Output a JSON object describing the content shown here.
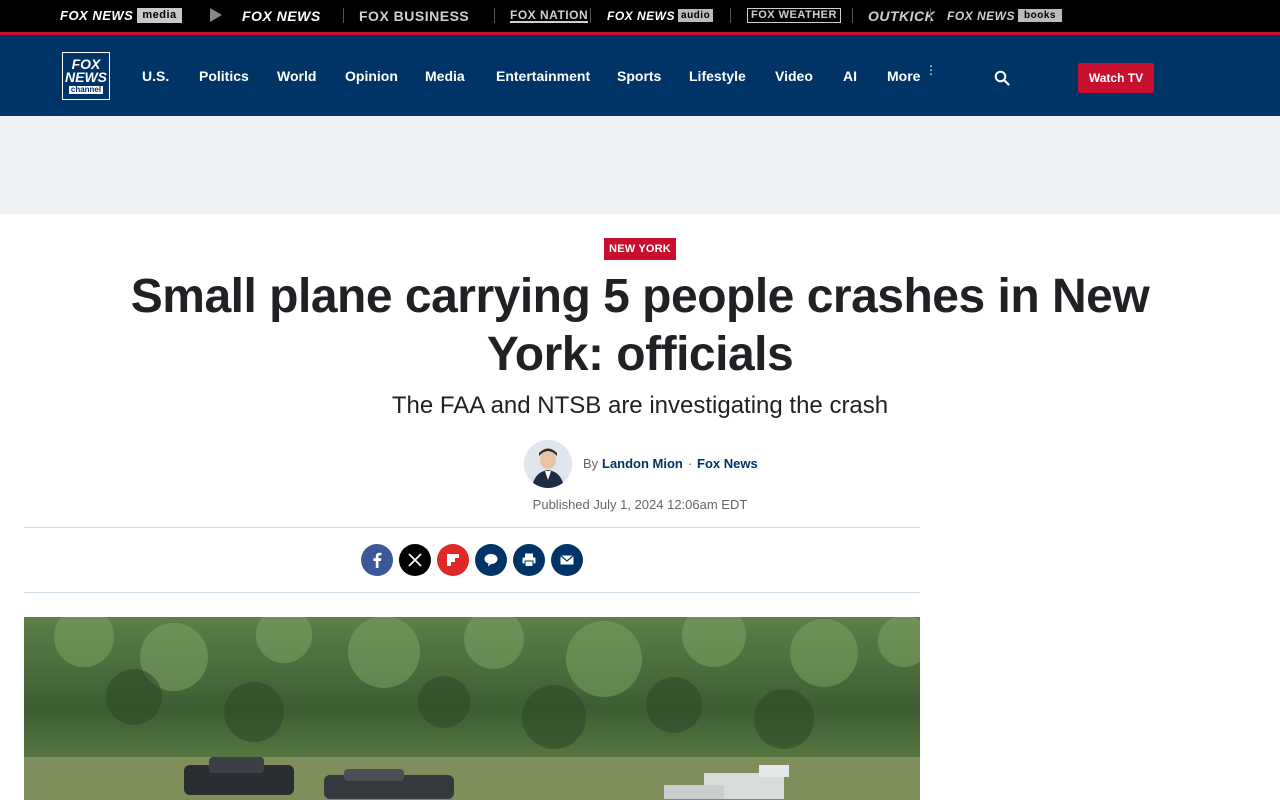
{
  "network": {
    "brands": {
      "media_fox": "FOX NEWS",
      "media_tag": "media",
      "news": "FOX NEWS",
      "business": "FOX BUSINESS",
      "nation": "FOX NATION",
      "audio_fox": "FOX NEWS",
      "audio_tag": "audio",
      "weather": "FOX WEATHER",
      "outkick": "OUTKICK",
      "books_fox": "FOX NEWS",
      "books_tag": "books"
    }
  },
  "header": {
    "logo": {
      "line1": "FOX",
      "line2": "NEWS",
      "line3": "channel"
    },
    "nav": [
      "U.S.",
      "Politics",
      "World",
      "Opinion",
      "Media",
      "Entertainment",
      "Sports",
      "Lifestyle",
      "Video",
      "AI",
      "More"
    ],
    "watch_tv": "Watch TV"
  },
  "article": {
    "category": "NEW YORK",
    "headline": "Small plane carrying 5 people crashes in New York: officials",
    "subhead": "The FAA and NTSB are investigating the crash",
    "byline": {
      "by": "By",
      "author": "Landon Mion",
      "separator": "·",
      "source": "Fox News"
    },
    "published": "Published July 1, 2024 12:06am EDT"
  },
  "colors": {
    "brand_navy": "#003366",
    "brand_red": "#c8102e",
    "ad_band": "#edf1f4"
  },
  "icons": {
    "share": [
      "facebook-icon",
      "x-icon",
      "flipboard-icon",
      "comment-icon",
      "print-icon",
      "email-icon"
    ],
    "search": "search-icon"
  }
}
